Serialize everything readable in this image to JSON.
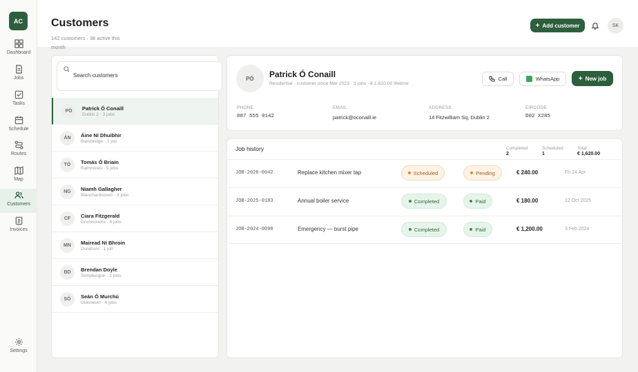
{
  "app": {
    "logo": "AC"
  },
  "nav": [
    {
      "label": "Dashboard",
      "icon": "grid-icon"
    },
    {
      "label": "Jobs",
      "icon": "document-icon"
    },
    {
      "label": "Tasks",
      "icon": "checkbox-icon"
    },
    {
      "label": "Schedule",
      "icon": "calendar-icon"
    },
    {
      "label": "Routes",
      "icon": "route-icon"
    },
    {
      "label": "Map",
      "icon": "map-icon"
    },
    {
      "label": "Customers",
      "icon": "users-icon",
      "active": true
    },
    {
      "label": "Invoices",
      "icon": "invoice-icon"
    },
    {
      "label": "Settings",
      "icon": "gear-icon"
    }
  ],
  "header": {
    "title": "Customers",
    "subtitle": "142 customers · 38 active this month",
    "add_label": "Add customer",
    "user_initials": "SK"
  },
  "search": {
    "placeholder": "Search customers"
  },
  "customers": [
    {
      "initials": "PÓ",
      "name": "Patrick Ó Conaill",
      "meta": "Dublin 2 · 3 jobs",
      "selected": true
    },
    {
      "initials": "ÁN",
      "name": "Áine Ní Dhuibhir",
      "meta": "Ballsbridge · 1 job"
    },
    {
      "initials": "TÓ",
      "name": "Tomás Ó Briain",
      "meta": "Rathmines · 5 jobs"
    },
    {
      "initials": "NG",
      "name": "Niamh Gallagher",
      "meta": "Blanchardstown · 2 jobs"
    },
    {
      "initials": "CF",
      "name": "Ciara Fitzgerald",
      "meta": "Drumcondra · 4 jobs"
    },
    {
      "initials": "MN",
      "name": "Mairead Ní Bhroin",
      "meta": "Dundrum · 1 job"
    },
    {
      "initials": "BD",
      "name": "Brendan Doyle",
      "meta": "Templeogue · 2 jobs"
    },
    {
      "initials": "SÓ",
      "name": "Seán Ó Murchú",
      "meta": "Glasnevin · 6 jobs"
    }
  ],
  "detail": {
    "initials": "PÓ",
    "name": "Patrick Ó Conaill",
    "meta": "Residential · customer since Mar 2023 · 3 jobs · € 1,620.00 lifetime",
    "call_label": "Call",
    "whatsapp_label": "WhatsApp",
    "newjob_label": "New job",
    "fields": [
      {
        "label": "PHONE",
        "value": "087 555 0142",
        "mono": true
      },
      {
        "label": "EMAIL",
        "value": "patrick@oconaill.ie"
      },
      {
        "label": "ADDRESS",
        "value": "14 Fitzwilliam Sq, Dublin 2"
      },
      {
        "label": "EIRCODE",
        "value": "D02 X285",
        "mono": true
      }
    ]
  },
  "job_history": {
    "title": "Job history",
    "stats": [
      {
        "label": "Completed",
        "value": "2"
      },
      {
        "label": "Scheduled",
        "value": "1"
      },
      {
        "label": "Total",
        "value": "€ 1,620.00"
      }
    ],
    "jobs": [
      {
        "id": "JOB-2026-0042",
        "desc": "Replace kitchen mixer tap",
        "status": "Scheduled",
        "payment": "Pending",
        "amount": "€ 240.00",
        "date": "Fri 24 Apr"
      },
      {
        "id": "JOB-2025-0183",
        "desc": "Annual boiler service",
        "status": "Completed",
        "payment": "Paid",
        "amount": "€ 180.00",
        "date": "12 Oct 2025"
      },
      {
        "id": "JOB-2024-0098",
        "desc": "Emergency — burst pipe",
        "status": "Completed",
        "payment": "Paid",
        "amount": "€ 1,200.00",
        "date": "3 Feb 2024"
      }
    ]
  },
  "colors": {
    "brand": "#2d5f3d",
    "paid": "#e6f4ea",
    "pending": "#fdf3e6"
  }
}
